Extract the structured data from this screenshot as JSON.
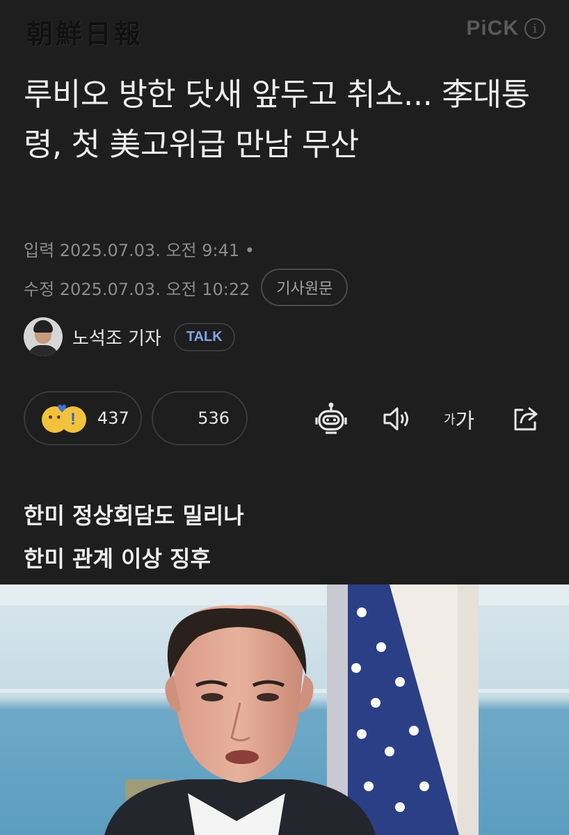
{
  "masthead": {
    "logo_text": "朝鮮日報",
    "pick_label": "PiCK",
    "info_icon": "i"
  },
  "article": {
    "headline": "루비오 방한 닷새 앞두고 취소... 李대통령, 첫 美고위급 만남 무산",
    "input_label": "입력 2025.07.03. 오전 9:41 •",
    "edit_label": "수정 2025.07.03. 오전 10:22",
    "original_button": "기사원문"
  },
  "reporter": {
    "name": "노석조 기자",
    "talk_label": "TALK"
  },
  "reactions": {
    "reaction_count": "437",
    "comment_count": "536"
  },
  "toolbar": {
    "icons": [
      "robot-summary-icon",
      "speaker-icon",
      "font-size-icon",
      "share-icon"
    ],
    "font_label_small": "가",
    "font_label_large": "가"
  },
  "subheadings": [
    "한미 정상회담도 밀리나",
    "한미 관계 이상 징후"
  ]
}
